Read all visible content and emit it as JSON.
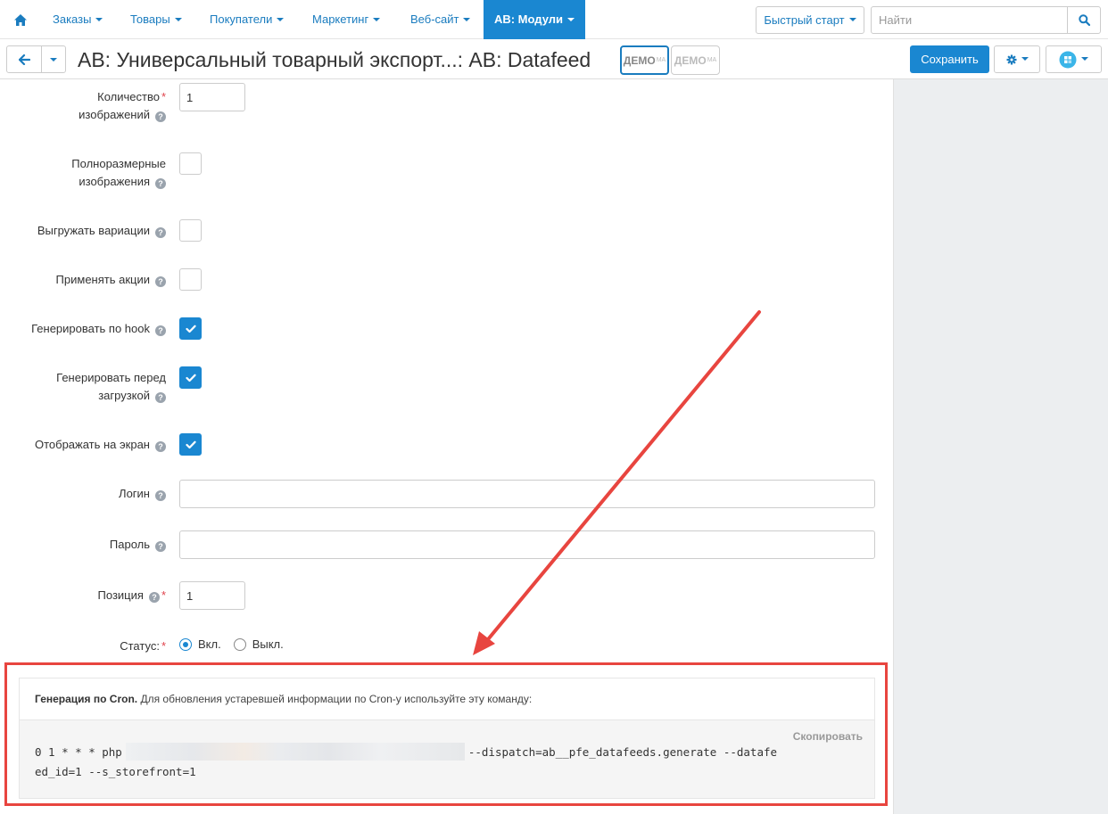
{
  "topnav": {
    "home_icon": "home-icon",
    "items": [
      {
        "label": "Заказы"
      },
      {
        "label": "Товары"
      },
      {
        "label": "Покупатели"
      },
      {
        "label": "Маркетинг"
      },
      {
        "label": "Веб-сайт"
      },
      {
        "label": "AB: Модули",
        "active": true
      }
    ],
    "quick_start": "Быстрый старт",
    "search_placeholder": "Найти",
    "search_icon": "search-icon"
  },
  "header": {
    "title": "AB: Универсальный товарный экспорт...: AB: Datafeed",
    "badges": [
      {
        "text": "ДЕМО",
        "sup": "МА"
      },
      {
        "text": "ДЕМО",
        "sup": "МА"
      }
    ],
    "save_label": "Сохранить"
  },
  "form": {
    "images_count": {
      "label_line1": "Количество",
      "label_line2": "изображений",
      "value": "1",
      "required": true
    },
    "full_size_images": {
      "label_line1": "Полноразмерные",
      "label_line2": "изображения",
      "checked": false
    },
    "export_variations": {
      "label": "Выгружать вариации",
      "checked": false
    },
    "apply_promotions": {
      "label": "Применять акции",
      "checked": false
    },
    "generate_by_hook": {
      "label": "Генерировать по hook",
      "checked": true
    },
    "generate_before_download": {
      "label_line1": "Генерировать перед",
      "label_line2": "загрузкой",
      "checked": true
    },
    "display_on_screen": {
      "label": "Отображать на экран",
      "checked": true
    },
    "login": {
      "label": "Логин",
      "value": ""
    },
    "password": {
      "label": "Пароль",
      "value": ""
    },
    "position": {
      "label": "Позиция",
      "value": "1",
      "required": true
    },
    "status": {
      "label": "Статус:",
      "required": true,
      "options": [
        "Вкл.",
        "Выкл."
      ],
      "selected": "Вкл."
    }
  },
  "cron": {
    "title": "Генерация по Cron.",
    "description": "Для обновления устаревшей информации по Cron-у используйте эту команду:",
    "copy_label": "Скопировать",
    "command_prefix": "0 1 * * * php",
    "command_suffix": "--dispatch=ab__pfe_datafeeds.generate --datafe",
    "command_line2": "ed_id=1 --s_storefront=1"
  },
  "colors": {
    "accent": "#1a87d1",
    "link": "#1a7cbf",
    "annotation": "#e8453f",
    "sidebar_bg": "#eceef0"
  }
}
